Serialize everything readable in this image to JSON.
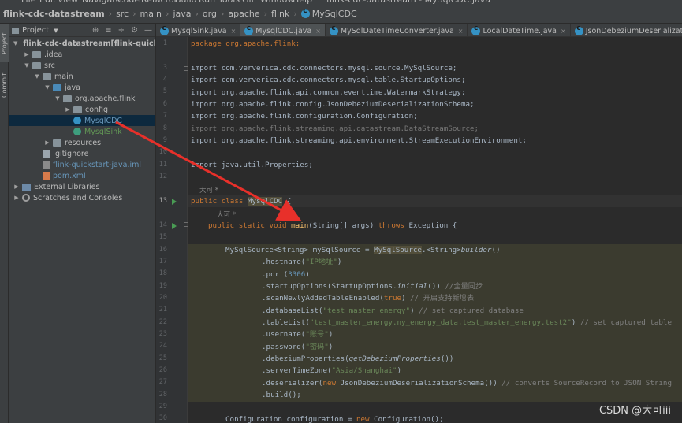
{
  "menubar": {
    "items": [
      "File",
      "Edit",
      "View",
      "Navigate",
      "Code",
      "Refactor",
      "Build",
      "Run",
      "Tools",
      "Git",
      "Window",
      "Help",
      "flink-cdc-datastream - MySqlCDC.java"
    ]
  },
  "breadcrumb": [
    "flink-cdc-datastream",
    "src",
    "main",
    "java",
    "org",
    "apache",
    "flink",
    "MySqlCDC"
  ],
  "project_panel": {
    "title": "Project",
    "tree": [
      {
        "label": "flink-cdc-datastream",
        "suffix": " [flink-quickstart-",
        "indent": 0,
        "arrow": "down",
        "icon": "folder"
      },
      {
        "label": ".idea",
        "indent": 1,
        "arrow": "right",
        "icon": "folder"
      },
      {
        "label": "src",
        "indent": 1,
        "arrow": "down",
        "icon": "folder"
      },
      {
        "label": "main",
        "indent": 2,
        "arrow": "down",
        "icon": "folder"
      },
      {
        "label": "java",
        "indent": 3,
        "arrow": "down",
        "icon": "folder-src"
      },
      {
        "label": "org.apache.flink",
        "indent": 4,
        "arrow": "down",
        "icon": "package"
      },
      {
        "label": "config",
        "indent": 5,
        "arrow": "right",
        "icon": "package"
      },
      {
        "label": "MysqlCDC",
        "indent": 5,
        "arrow": "",
        "icon": "class",
        "selected": true
      },
      {
        "label": "MysqlSink",
        "indent": 5,
        "arrow": "",
        "icon": "class-green"
      },
      {
        "label": "resources",
        "indent": 3,
        "arrow": "right",
        "icon": "folder"
      },
      {
        "label": ".gitignore",
        "indent": 2,
        "arrow": "",
        "icon": "file"
      },
      {
        "label": "flink-quickstart-java.iml",
        "indent": 2,
        "arrow": "",
        "icon": "iml"
      },
      {
        "label": "pom.xml",
        "indent": 2,
        "arrow": "",
        "icon": "xml"
      },
      {
        "label": "External Libraries",
        "indent": 0,
        "arrow": "right",
        "icon": "lib"
      },
      {
        "label": "Scratches and Consoles",
        "indent": 0,
        "arrow": "right",
        "icon": "scratch"
      }
    ]
  },
  "sidebar_tabs": {
    "project": "Project",
    "commit": "Commit"
  },
  "tabs": [
    {
      "label": "MysqlSink.java",
      "active": false
    },
    {
      "label": "MysqlCDC.java",
      "active": true
    },
    {
      "label": "MySqlDateTimeConverter.java",
      "active": false
    },
    {
      "label": "LocalDateTime.java",
      "active": false
    },
    {
      "label": "JsonDebeziumDeserializationSchema.java",
      "active": false
    }
  ],
  "editor": {
    "line_numbers": [
      "1",
      "",
      "3",
      "4",
      "5",
      "6",
      "7",
      "8",
      "9",
      "10",
      "11",
      "12",
      "",
      "13",
      "",
      "14",
      "15",
      "16",
      "17",
      "18",
      "19",
      "20",
      "21",
      "22",
      "23",
      "24",
      "25",
      "26",
      "27",
      "28",
      "29",
      "30"
    ],
    "author_annotation": "大可 *",
    "package_line": "package org.apache.flink;",
    "imports": [
      "import com.ververica.cdc.connectors.mysql.source.MySqlSource;",
      "import com.ververica.cdc.connectors.mysql.table.StartupOptions;",
      "import org.apache.flink.api.common.eventtime.WatermarkStrategy;",
      "import org.apache.flink.config.JsonDebeziumDeserializationSchema;",
      "import org.apache.flink.configuration.Configuration;",
      "import org.apache.flink.streaming.api.datastream.DataStreamSource;",
      "import org.apache.flink.streaming.api.environment.StreamExecutionEnvironment;",
      "",
      "import java.util.Properties;"
    ],
    "class_decl": [
      "public class ",
      "MysqlCDC",
      " {"
    ],
    "main_decl": [
      "public static void ",
      "main",
      "(String[] args) ",
      "throws",
      " Exception {"
    ],
    "builder_start": [
      "MySqlSource<String> mySqlSource = ",
      "MySqlSource",
      ".<String>",
      "builder",
      "()"
    ],
    "chain": [
      {
        "pre": ".hostname(",
        "str": "\"IP地址\"",
        "post": ")"
      },
      {
        "pre": ".port(",
        "num": "3306",
        "post": ")"
      },
      {
        "pre": ".startupOptions(StartupOptions.",
        "it": "initial",
        "post": "()) ",
        "cmt": "//全量同步"
      },
      {
        "pre": ".scanNewlyAddedTableEnabled(",
        "kw": "true",
        "post": ") ",
        "cmt": "// 开启支持新增表"
      },
      {
        "pre": ".databaseList(",
        "str": "\"test_master_energy\"",
        "post": ") ",
        "cmt": "// set captured database"
      },
      {
        "pre": ".tableList(",
        "str": "\"test_master_energy.ny_energy_data,test_master_energy.test2\"",
        "post": ") ",
        "cmt": "// set captured table"
      },
      {
        "pre": ".username(",
        "str": "\"账号\"",
        "post": ")"
      },
      {
        "pre": ".password(",
        "str": "\"密码\"",
        "post": ")"
      },
      {
        "pre": ".debeziumProperties(",
        "it": "getDebeziumProperties",
        "post": "())"
      },
      {
        "pre": ".serverTimeZone(",
        "str": "\"Asia/Shanghai\"",
        "post": ")"
      },
      {
        "pre": ".deserializer(",
        "kw": "new",
        "post": " JsonDebeziumDeserializationSchema()) ",
        "cmt": "// converts SourceRecord to JSON String"
      },
      {
        "pre": ".build();",
        "post": ""
      }
    ],
    "config_line": [
      "Configuration configuration = ",
      "new",
      " Configuration();"
    ]
  },
  "watermark": "CSDN @大可iii",
  "colors": {
    "keyword": "#cc7832",
    "string": "#6a8759",
    "number": "#6897bb",
    "comment": "#808080",
    "arrow": "#e8302a",
    "highlight": "#3b3b2f"
  }
}
